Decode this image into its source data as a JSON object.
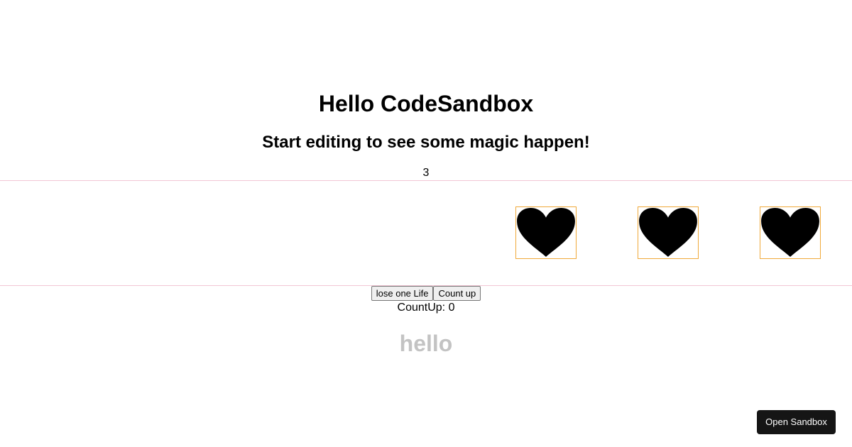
{
  "header": {
    "title": "Hello CodeSandbox",
    "subtitle": "Start editing to see some magic happen!"
  },
  "lives": {
    "count": "3",
    "hearts": [
      {
        "icon": "heart-icon",
        "color": "#000000"
      },
      {
        "icon": "heart-icon",
        "color": "#000000"
      },
      {
        "icon": "heart-icon",
        "color": "#000000"
      }
    ],
    "box_border_color": "#f0a93a",
    "strip_border_color": "#f2c6d4"
  },
  "controls": {
    "lose_life_label": "lose one Life",
    "count_up_label": "Count up"
  },
  "counter": {
    "text": "CountUp: 0"
  },
  "footer_text": {
    "hello": "hello",
    "color": "#c3c3c3"
  },
  "open_sandbox": {
    "label": "Open Sandbox",
    "background": "#151515"
  }
}
